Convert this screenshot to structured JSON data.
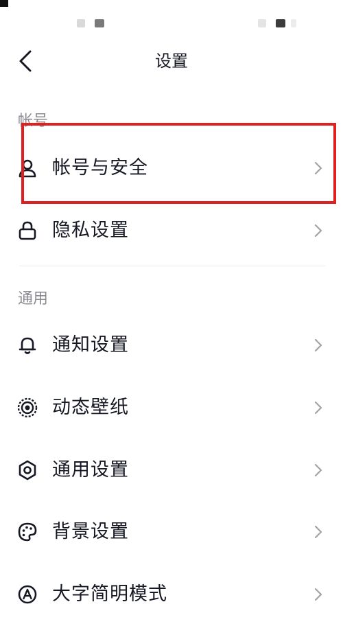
{
  "nav": {
    "title": "设置"
  },
  "sections": {
    "account": "帐号",
    "general": "通用"
  },
  "items": [
    {
      "label": "帐号与安全",
      "icon": "person-icon"
    },
    {
      "label": "隐私设置",
      "icon": "lock-icon"
    },
    {
      "label": "通知设置",
      "icon": "bell-icon"
    },
    {
      "label": "动态壁纸",
      "icon": "live-wallpaper-icon"
    },
    {
      "label": "通用设置",
      "icon": "gear-icon"
    },
    {
      "label": "背景设置",
      "icon": "palette-icon"
    },
    {
      "label": "大字简明模式",
      "icon": "text-size-icon"
    }
  ],
  "colors": {
    "text": "#161823",
    "section_text": "#8a8b91",
    "chevron": "#a1a2a7",
    "highlight": "#e02020",
    "divider": "#ececec"
  }
}
